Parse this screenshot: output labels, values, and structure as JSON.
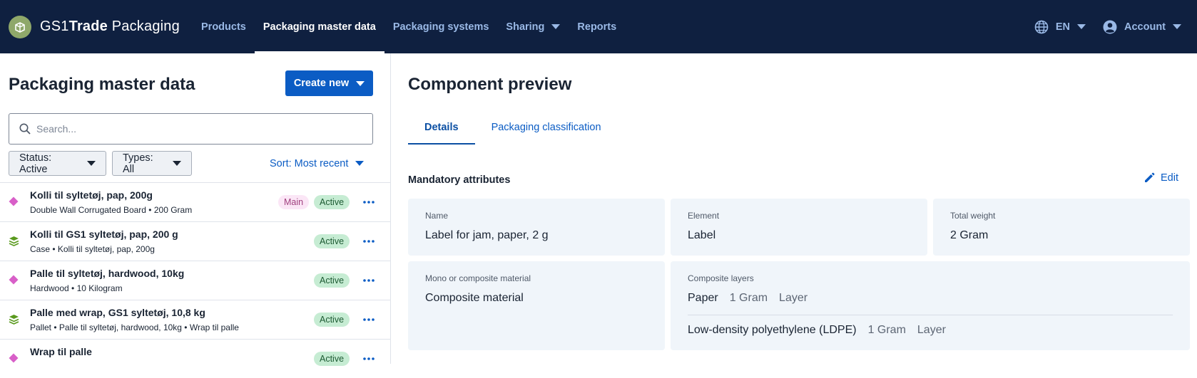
{
  "header": {
    "brand_prefix": "GS1",
    "brand_bold": "Trade",
    "brand_suffix": " Packaging",
    "nav": [
      {
        "label": "Products",
        "active": false
      },
      {
        "label": "Packaging master data",
        "active": true
      },
      {
        "label": "Packaging systems",
        "active": false
      },
      {
        "label": "Sharing",
        "active": false,
        "dropdown": true
      },
      {
        "label": "Reports",
        "active": false
      }
    ],
    "language": "EN",
    "account": "Account",
    "colors": {
      "bar": "#0f2040",
      "link": "#9ab9e6"
    }
  },
  "left": {
    "title": "Packaging master data",
    "create_label": "Create new",
    "search_placeholder": "Search...",
    "status_filter": "Status: Active",
    "types_filter": "Types: All",
    "sort": "Sort: Most recent",
    "items": [
      {
        "icon": "diamond-icon",
        "title": "Kolli til syltetøj, pap, 200g",
        "subtitle": "Double Wall Corrugated Board • 200 Gram",
        "main": "Main",
        "status": "Active"
      },
      {
        "icon": "layers-icon",
        "title": "Kolli til GS1 syltetøj, pap, 200 g",
        "subtitle": "Case • Kolli til syltetøj, pap, 200g",
        "main": "",
        "status": "Active"
      },
      {
        "icon": "diamond-icon",
        "title": "Palle til syltetøj, hardwood, 10kg",
        "subtitle": "Hardwood • 10 Kilogram",
        "main": "",
        "status": "Active"
      },
      {
        "icon": "layers-icon",
        "title": "Palle med wrap, GS1 syltetøj, 10,8 kg",
        "subtitle": "Pallet • Palle til syltetøj, hardwood, 10kg • Wrap til palle",
        "main": "",
        "status": "Active"
      },
      {
        "icon": "diamond-icon",
        "title": "Wrap til palle",
        "subtitle": "",
        "main": "",
        "status": "Active"
      }
    ]
  },
  "right": {
    "title": "Component preview",
    "tabs": [
      {
        "label": "Details",
        "active": true
      },
      {
        "label": "Packaging classification",
        "active": false
      }
    ],
    "section_title": "Mandatory attributes",
    "edit_label": "Edit",
    "fields": {
      "name": {
        "label": "Name",
        "value": "Label for jam, paper, 2 g"
      },
      "element": {
        "label": "Element",
        "value": "Label"
      },
      "total_weight": {
        "label": "Total weight",
        "value": "2 Gram"
      },
      "material": {
        "label": "Mono or composite material",
        "value": "Composite material"
      }
    },
    "layers_label": "Composite layers",
    "layers": [
      {
        "name": "Paper",
        "qty": "1 Gram",
        "type": "Layer"
      },
      {
        "name": "Low-density polyethylene (LDPE)",
        "qty": "1 Gram",
        "type": "Layer"
      }
    ]
  },
  "colors": {
    "primary": "#0b5cc4",
    "active_badge": "#c6ecd3",
    "main_badge": "#fbe6f6",
    "diamond": "#d85fc8",
    "layers": "#5a9a1e"
  }
}
